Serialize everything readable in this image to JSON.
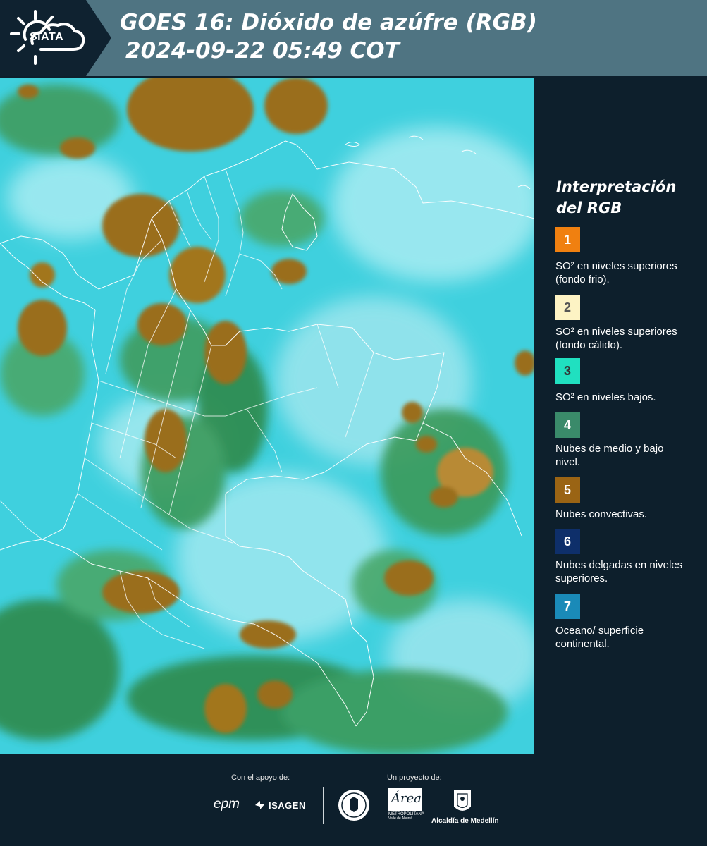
{
  "header": {
    "logo_text": "SIATA",
    "title_line1": "GOES 16: Dióxido de azúfre (RGB)",
    "title_line2": "2024-09-22 05:49 COT"
  },
  "legend": {
    "title_line1": "Interpretación",
    "title_line2": "del RGB",
    "items": [
      {
        "number": "1",
        "color": "#f08010",
        "text_color": "#ffffff",
        "label": "SO² en niveles superiores (fondo frio)."
      },
      {
        "number": "2",
        "color": "#fdf3c4",
        "text_color": "#555555",
        "label": "SO² en niveles superiores (fondo cálido)."
      },
      {
        "number": "3",
        "color": "#20e0c0",
        "text_color": "#333333",
        "label": "SO² en niveles bajos."
      },
      {
        "number": "4",
        "color": "#3a8a6a",
        "text_color": "#ffffff",
        "label": "Nubes de medio y bajo nivel."
      },
      {
        "number": "5",
        "color": "#9a6414",
        "text_color": "#ffffff",
        "label": "Nubes convectivas."
      },
      {
        "number": "6",
        "color": "#0e2f6a",
        "text_color": "#ffffff",
        "label": "Nubes delgadas en niveles superiores."
      },
      {
        "number": "7",
        "color": "#1a8ab8",
        "text_color": "#ffffff",
        "label": "Oceano/ superficie continental."
      }
    ]
  },
  "footer": {
    "support_label": "Con el apoyo de:",
    "project_label": "Un proyecto de:",
    "sponsor1": "epm",
    "sponsor2": "ISAGEN",
    "partner_area": "Área",
    "partner_area_sub": "METROPOLITANA",
    "partner_area_sub2": "Valle de Aburrá",
    "partner_alcaldia": "Alcaldía de Medellín"
  },
  "map": {
    "colors": {
      "background": "#3fd0de",
      "haze": "#a8ecf2",
      "green_low": "#2e8a4c",
      "green_mid": "#4aa86a",
      "convective": "#9a6e1c",
      "convective_light": "#b88a36",
      "borders": "#ffffff"
    }
  }
}
